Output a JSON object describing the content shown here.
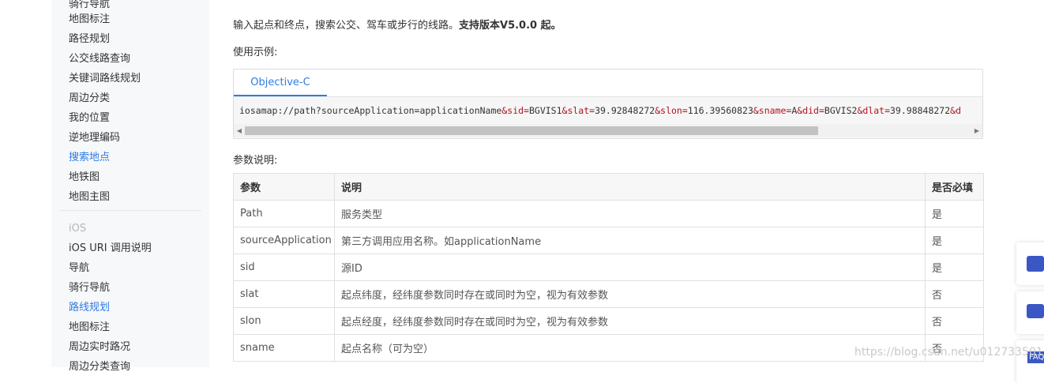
{
  "sidebar": {
    "items_top": [
      {
        "label": "骑行导航"
      },
      {
        "label": "地图标注"
      },
      {
        "label": "路径规划"
      },
      {
        "label": "公交线路查询"
      },
      {
        "label": "关键词路线规划"
      },
      {
        "label": "周边分类"
      },
      {
        "label": "我的位置"
      },
      {
        "label": "逆地理编码"
      },
      {
        "label": "搜索地点"
      },
      {
        "label": "地铁图"
      },
      {
        "label": "地图主图"
      }
    ],
    "group_label": "iOS",
    "items_ios": [
      {
        "label": "iOS URI 调用说明"
      },
      {
        "label": "导航"
      },
      {
        "label": "骑行导航"
      },
      {
        "label": "路线规划"
      },
      {
        "label": "地图标注"
      },
      {
        "label": "周边实时路况"
      },
      {
        "label": "周边分类查询"
      }
    ]
  },
  "main": {
    "description_normal": "输入起点和终点，搜索公交、驾车或步行的线路。",
    "description_bold": "支持版本V5.0.0 起。",
    "usage_label": "使用示例:",
    "code_tab": "Objective-C",
    "code": [
      {
        "t": "iosamap://path?sourceApplication=applicationName",
        "c": "p"
      },
      {
        "t": "&sid=",
        "c": "a"
      },
      {
        "t": "BGVIS1",
        "c": "p"
      },
      {
        "t": "&slat=",
        "c": "a"
      },
      {
        "t": "39.92848272",
        "c": "p"
      },
      {
        "t": "&slon=",
        "c": "a"
      },
      {
        "t": "116.39560823",
        "c": "p"
      },
      {
        "t": "&sname=",
        "c": "a"
      },
      {
        "t": "A",
        "c": "p"
      },
      {
        "t": "&did=",
        "c": "a"
      },
      {
        "t": "BGVIS2",
        "c": "p"
      },
      {
        "t": "&dlat=",
        "c": "a"
      },
      {
        "t": "39.98848272",
        "c": "p"
      },
      {
        "t": "&d",
        "c": "a"
      }
    ],
    "params_label": "参数说明:",
    "table": {
      "headers": [
        "参数",
        "说明",
        "是否必填"
      ],
      "rows": [
        [
          "Path",
          "服务类型",
          "是"
        ],
        [
          "sourceApplication",
          "第三方调用应用名称。如applicationName",
          "是"
        ],
        [
          "sid",
          "源ID",
          "是"
        ],
        [
          "slat",
          "起点纬度，经纬度参数同时存在或同时为空，视为有效参数",
          "否"
        ],
        [
          "slon",
          "起点经度，经纬度参数同时存在或同时为空，视为有效参数",
          "否"
        ],
        [
          "sname",
          "起点名称（可为空）",
          "否"
        ]
      ]
    }
  },
  "watermark": "https://blog.csdn.net/u012733501",
  "float_btn_faq": "FAQ",
  "colors": {
    "accent": "#2d7be5",
    "param_red": "#b3121f",
    "float_icon": "#3a57c4"
  }
}
